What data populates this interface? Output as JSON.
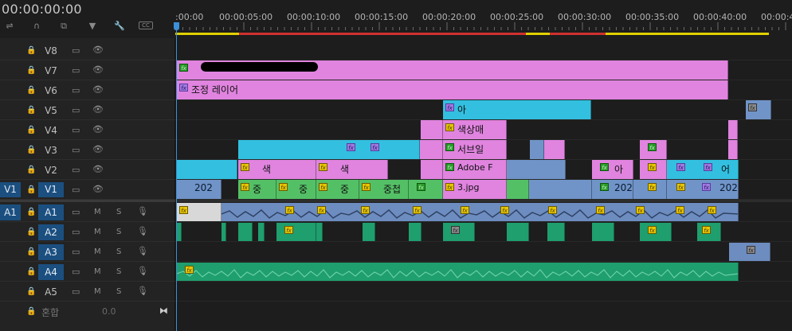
{
  "timecode": "00:00:00:00",
  "toolbar": {
    "icons": [
      "insert-icon",
      "snap-icon",
      "linked-selection-icon",
      "add-marker-icon",
      "settings-wrench-icon",
      "captions-icon"
    ],
    "captions_label": "CC"
  },
  "ruler": {
    "labels": [
      ":00:00",
      "00:00:05:00",
      "00:00:10:00",
      "00:00:15:00",
      "00:00:20:00",
      "00:00:25:00",
      "00:00:30:00",
      "00:00:35:00",
      "00:00:40:00",
      "00:00:4"
    ],
    "render_bar_colors": [
      "#e0d000",
      "#d03030"
    ]
  },
  "video_tracks": [
    {
      "name": "V8"
    },
    {
      "name": "V7"
    },
    {
      "name": "V6"
    },
    {
      "name": "V5"
    },
    {
      "name": "V4"
    },
    {
      "name": "V3"
    },
    {
      "name": "V2"
    },
    {
      "name": "V1",
      "source": "V1",
      "targeted": true
    }
  ],
  "audio_tracks": [
    {
      "name": "A1",
      "source": "A1",
      "targeted": true
    },
    {
      "name": "A2",
      "targeted": true
    },
    {
      "name": "A3",
      "targeted": true
    },
    {
      "name": "A4",
      "targeted": true
    },
    {
      "name": "A5",
      "targeted": false
    }
  ],
  "audio_button_labels": {
    "mute": "M",
    "solo": "S"
  },
  "mix": {
    "label": "혼합",
    "value": "0.0"
  },
  "clips": {
    "v6_label": "조정 레이어",
    "v5_label": "아",
    "v4_label": "색상매",
    "v3_label": "서브일",
    "v2_labels": [
      "색",
      "색",
      "Adobe F",
      "아",
      "어"
    ],
    "v1_labels": [
      "202",
      "중",
      "중",
      "중",
      "중첩",
      "3.jpg",
      "202",
      "202"
    ]
  },
  "colors": {
    "video_pink": "#e084df",
    "video_cyan": "#33bfe0",
    "video_green": "#54c066",
    "audio_blue": "#6d8cc0",
    "audio_green": "#1f9e6e",
    "track_target": "#1b4f80",
    "playhead": "#3c8fd8"
  }
}
